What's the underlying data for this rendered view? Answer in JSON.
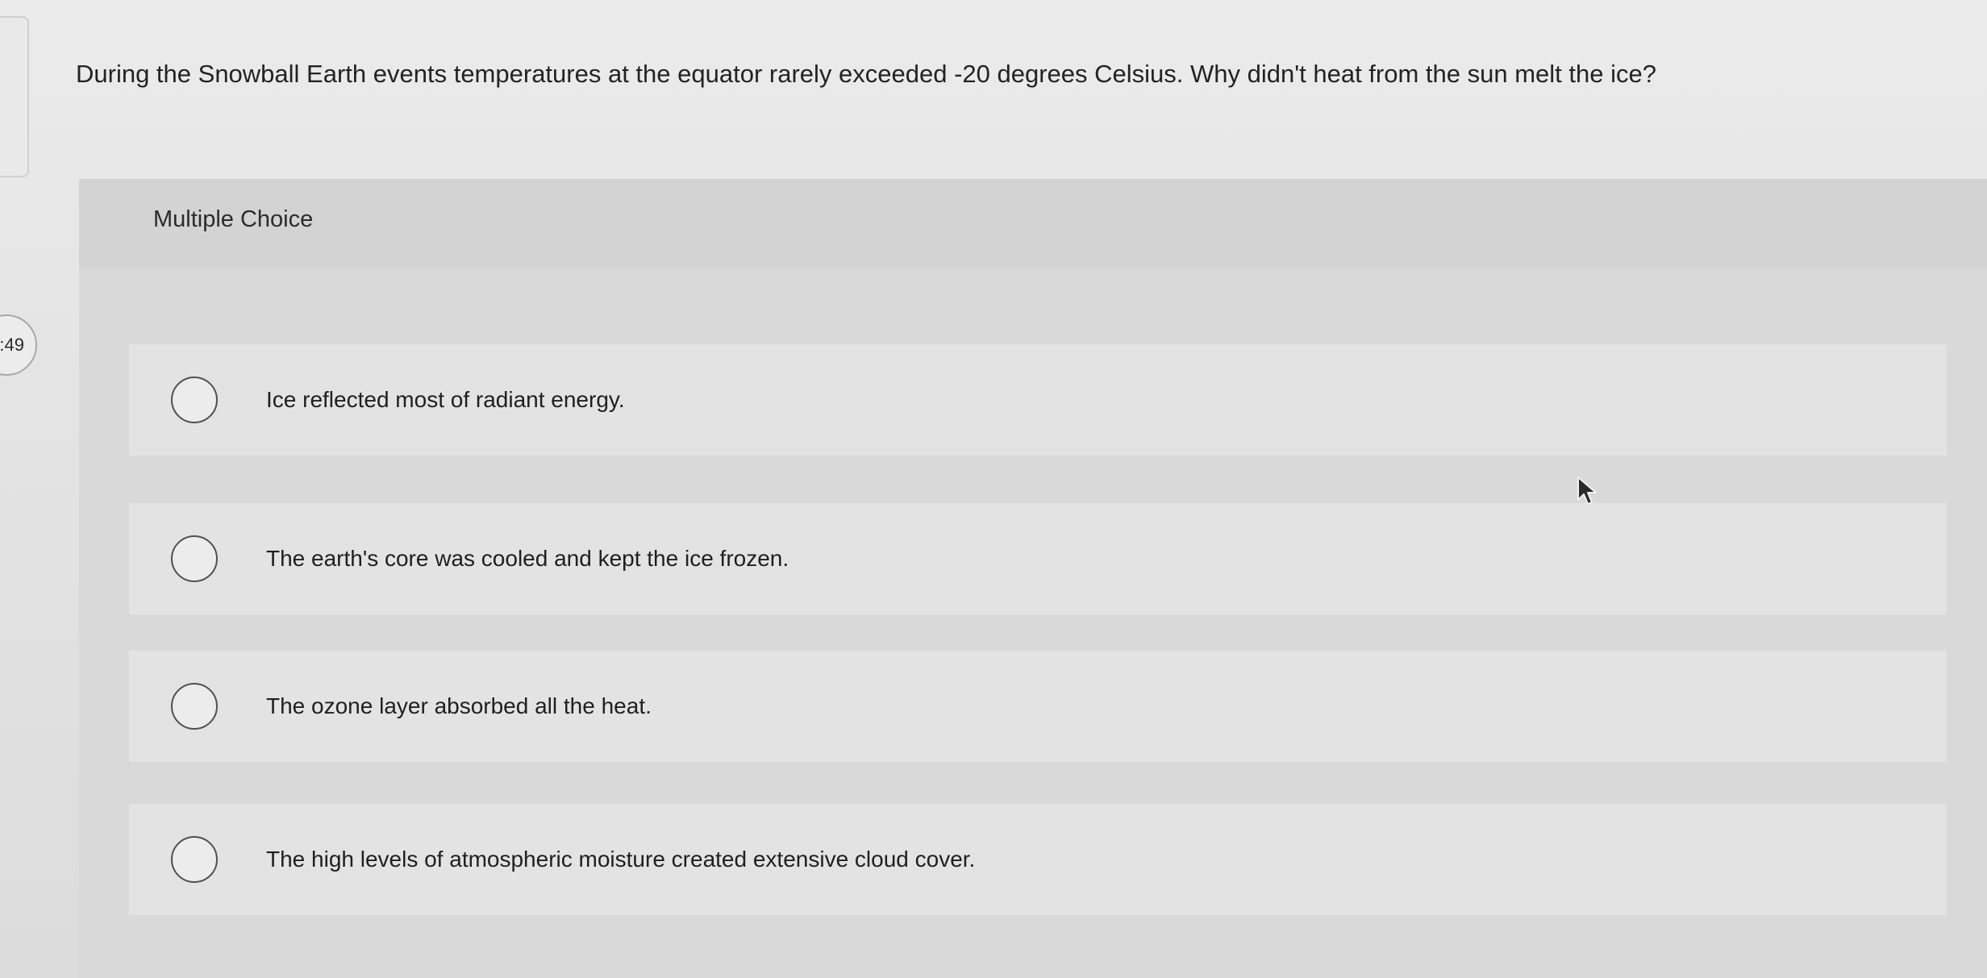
{
  "timer": {
    "text": ":49"
  },
  "question": {
    "text": "During the Snowball Earth events temperatures at the equator rarely exceeded -20 degrees Celsius. Why didn't heat from the sun melt the ice?"
  },
  "choice_block": {
    "type_label": "Multiple Choice",
    "options": [
      {
        "label": "Ice reflected most of radiant energy."
      },
      {
        "label": "The earth's core was cooled and kept the ice frozen."
      },
      {
        "label": "The ozone layer absorbed all the heat."
      },
      {
        "label": "The high levels of atmospheric moisture created extensive cloud cover."
      }
    ]
  },
  "icons": {
    "radio": "radio-circle-icon",
    "cursor": "mouse-pointer-icon"
  }
}
